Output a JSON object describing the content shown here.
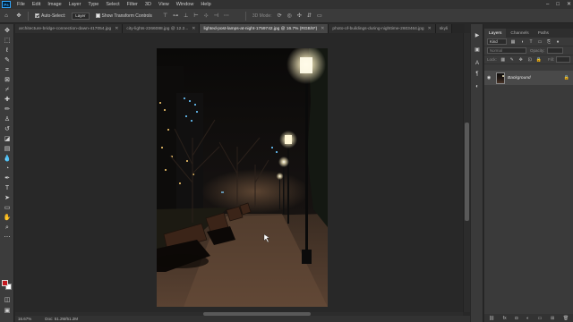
{
  "app": {
    "logo": "Ps"
  },
  "menu": [
    "File",
    "Edit",
    "Image",
    "Layer",
    "Type",
    "Select",
    "Filter",
    "3D",
    "View",
    "Window",
    "Help"
  ],
  "window_controls": [
    "–",
    "□",
    "✕"
  ],
  "options": {
    "auto_select_label": "Auto-Select:",
    "auto_select_value": "Layer",
    "show_transform_label": "Show Transform Controls",
    "mode_label": "3D Mode:"
  },
  "tabs": [
    {
      "label": "architecture-bridge-connection-dawn-417054.jpg",
      "active": false
    },
    {
      "label": "city-lights-2266088.jpg @ 12.2...",
      "active": false
    },
    {
      "label": "lighted-post-lamps-at-night-1759742.jpg @ 16.7% (RGB/8*)",
      "active": true
    },
    {
      "label": "photo-of-buildings-during-nighttime-2603464.jpg",
      "active": false
    },
    {
      "label": "skyli",
      "active": false
    }
  ],
  "status": {
    "zoom": "16.67%",
    "doc": "Doc: 51.2M/51.2M"
  },
  "layers_panel": {
    "tabs": [
      "Layers",
      "Channels",
      "Paths"
    ],
    "kind": "Kind",
    "blend_mode": "Normal",
    "opacity_label": "Opacity:",
    "lock_label": "Lock:",
    "fill_label": "Fill:",
    "layer_name": "Background"
  },
  "colors": {
    "foreground": "#c4191f",
    "background": "#ffffff",
    "accent": "#31a8ff"
  }
}
